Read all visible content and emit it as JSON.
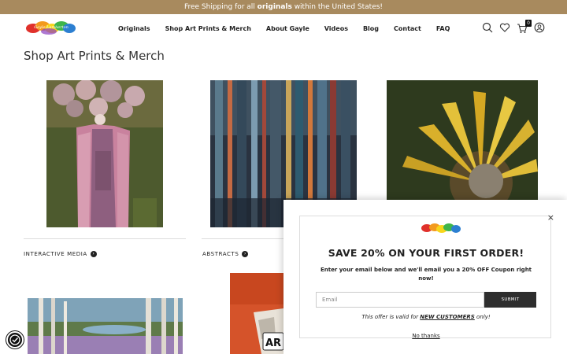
{
  "promo": {
    "prefix": "Free Shipping for all ",
    "highlight": "originals",
    "suffix": " within the United States!"
  },
  "header": {
    "logo_text": "Gayle Lamberton",
    "nav": [
      "Originals",
      "Shop Art Prints & Merch",
      "About Gayle",
      "Videos",
      "Blog",
      "Contact",
      "FAQ"
    ],
    "cart_count": "0"
  },
  "page": {
    "title": "Shop Art Prints & Merch"
  },
  "categories": [
    {
      "label": "INTERACTIVE MEDIA"
    },
    {
      "label": "ABSTRACTS"
    }
  ],
  "modal": {
    "heading": "SAVE 20% ON YOUR FIRST ORDER!",
    "body": "Enter your email below and we'll email you a 20% OFF Coupon right now!",
    "email_placeholder": "Email",
    "submit_label": "SUBMIT",
    "offer_prefix": "This offer is valid for ",
    "offer_highlight": "NEW CUSTOMERS",
    "offer_suffix": " only!",
    "no_thanks": "No thanks",
    "close_label": "×"
  },
  "art_logo_text": "AR",
  "colors": {
    "promo_bar": "#a88a5e",
    "submit_bg": "#2e2e2e"
  }
}
